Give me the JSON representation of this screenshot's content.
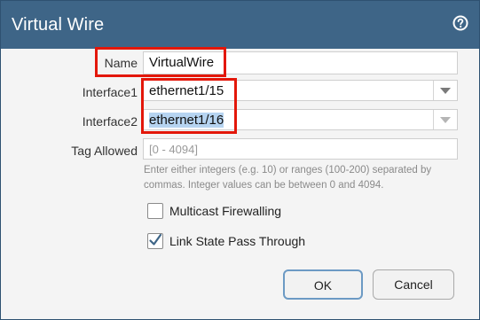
{
  "dialog": {
    "title": "Virtual Wire",
    "help_icon": "help-circle-icon"
  },
  "form": {
    "name_label": "Name",
    "name_value": "VirtualWire",
    "interface1_label": "Interface1",
    "interface1_value": "ethernet1/15",
    "interface2_label": "Interface2",
    "interface2_value": "ethernet1/16",
    "tag_label": "Tag Allowed",
    "tag_placeholder": "[0 - 4094]",
    "tag_hint": "Enter either integers (e.g. 10) or ranges (100-200) separated by commas. Integer values can be between 0 and 4094.",
    "multicast_label": "Multicast Firewalling",
    "multicast_checked": false,
    "linkstate_label": "Link State Pass Through",
    "linkstate_checked": true
  },
  "buttons": {
    "ok_label": "OK",
    "cancel_label": "Cancel"
  },
  "colors": {
    "titlebar": "#3e6587",
    "highlight": "#e3170a",
    "selection": "#b6d4f1"
  }
}
